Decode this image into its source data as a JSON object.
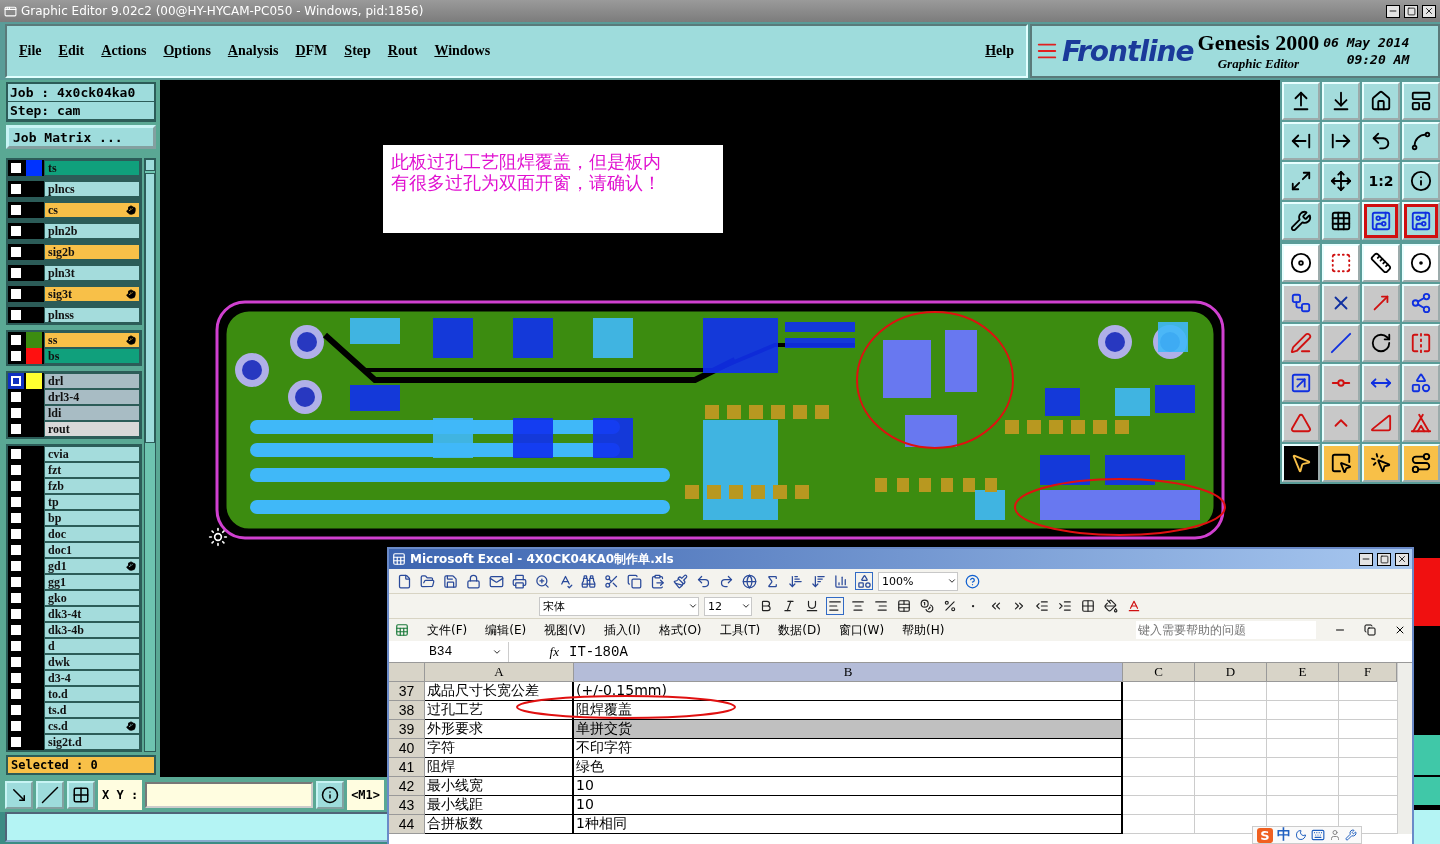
{
  "window": {
    "title": "Graphic Editor 9.02c2 (00@HY-HYCAM-PC050 - Windows, pid:1856)"
  },
  "menu": [
    "File",
    "Edit",
    "Actions",
    "Options",
    "Analysis",
    "DFM",
    "Step",
    "Rout",
    "Windows"
  ],
  "help_menu": "Help",
  "brand": {
    "logo": "Frontline",
    "product": "Genesis 2000",
    "subtitle": "Graphic Editor",
    "date": "06 May 2014",
    "time": "09:20 AM"
  },
  "job": {
    "job": "Job : 4x0ck04ka0",
    "step": "Step: cam",
    "matrix_button": "Job Matrix ..."
  },
  "layer_groups": [
    [
      {
        "name": "ts",
        "kind": "mask",
        "color": "#0033ff",
        "marked": false,
        "selected": false
      },
      {
        "name": "plncs",
        "kind": "plane",
        "marked": false,
        "selected": false
      },
      {
        "name": "cs",
        "kind": "signal",
        "marked": true,
        "selected": false
      },
      {
        "name": "pln2b",
        "kind": "plane",
        "marked": false,
        "selected": false
      },
      {
        "name": "sig2b",
        "kind": "signal",
        "marked": false,
        "selected": false
      },
      {
        "name": "pln3t",
        "kind": "plane",
        "marked": false,
        "selected": false
      },
      {
        "name": "sig3t",
        "kind": "signal",
        "marked": true,
        "selected": false
      },
      {
        "name": "plnss",
        "kind": "plane",
        "marked": false,
        "selected": false
      }
    ],
    [
      {
        "name": "ss",
        "kind": "signal",
        "color": "#3c8c10",
        "marked": true,
        "selected": false
      },
      {
        "name": "bs",
        "kind": "mask",
        "color": "#ff1010",
        "marked": false,
        "selected": false
      }
    ],
    [
      {
        "name": "drl",
        "kind": "drill",
        "color": "#ffff30",
        "marked": false,
        "selected": true
      },
      {
        "name": "drl3-4",
        "kind": "drill",
        "marked": false,
        "selected": false
      },
      {
        "name": "ldi",
        "kind": "drill",
        "marked": false,
        "selected": false
      },
      {
        "name": "rout",
        "kind": "rout",
        "marked": false,
        "selected": false
      }
    ],
    [
      {
        "name": "cvia",
        "kind": "document",
        "marked": false,
        "selected": false
      },
      {
        "name": "fzt",
        "kind": "document",
        "marked": false,
        "selected": false
      },
      {
        "name": "fzb",
        "kind": "document",
        "marked": false,
        "selected": false
      },
      {
        "name": "tp",
        "kind": "document",
        "marked": false,
        "selected": false
      },
      {
        "name": "bp",
        "kind": "document",
        "marked": false,
        "selected": false
      },
      {
        "name": "doc",
        "kind": "document",
        "marked": false,
        "selected": false
      },
      {
        "name": "doc1",
        "kind": "document",
        "marked": false,
        "selected": false
      },
      {
        "name": "gd1",
        "kind": "document",
        "marked": true,
        "selected": false
      },
      {
        "name": "gg1",
        "kind": "document",
        "marked": false,
        "selected": false
      },
      {
        "name": "gko",
        "kind": "document",
        "marked": false,
        "selected": false
      },
      {
        "name": "dk3-4t",
        "kind": "document",
        "marked": false,
        "selected": false
      },
      {
        "name": "dk3-4b",
        "kind": "document",
        "marked": false,
        "selected": false
      },
      {
        "name": "d",
        "kind": "document",
        "marked": false,
        "selected": false
      },
      {
        "name": "dwk",
        "kind": "document",
        "marked": false,
        "selected": false
      },
      {
        "name": "d3-4",
        "kind": "document",
        "marked": false,
        "selected": false
      },
      {
        "name": "to.d",
        "kind": "document",
        "marked": false,
        "selected": false
      },
      {
        "name": "ts.d",
        "kind": "document",
        "marked": false,
        "selected": false
      },
      {
        "name": "cs.d",
        "kind": "document",
        "marked": true,
        "selected": false
      },
      {
        "name": "sig2t.d",
        "kind": "document",
        "marked": false,
        "selected": false
      }
    ]
  ],
  "selected_count": "Selected : 0",
  "coord": {
    "label": "X Y :",
    "units": "<M1>"
  },
  "canvas_note": "此板过孔工艺阻焊覆盖，但是板内有很多过孔为双面开窗，请确认！",
  "view_tools": [
    {
      "highlighted": false
    },
    {
      "highlighted": false
    },
    {
      "highlighted": false
    },
    {
      "highlighted": false
    },
    {
      "highlighted": false
    },
    {
      "highlighted": false
    },
    {
      "highlighted": false
    },
    {
      "highlighted": false
    },
    {
      "highlighted": false
    },
    {
      "highlighted": false
    },
    {
      "highlighted": false,
      "label": "1:2"
    },
    {
      "highlighted": false
    },
    {
      "highlighted": false
    },
    {
      "highlighted": false
    },
    {
      "highlighted": true
    },
    {
      "highlighted": true
    }
  ],
  "pointer_tools": [
    {
      "selected": true
    },
    {
      "selected": false
    },
    {
      "selected": false
    },
    {
      "selected": false
    }
  ],
  "excel": {
    "title": "Microsoft Excel - 4X0CK04KA0制作单.xls",
    "zoom": "100%",
    "font": "宋体",
    "size": "12",
    "menu": [
      "文件(F)",
      "编辑(E)",
      "视图(V)",
      "插入(I)",
      "格式(O)",
      "工具(T)",
      "数据(D)",
      "窗口(W)",
      "帮助(H)"
    ],
    "help_placeholder": "键入需要帮助的问题",
    "cell_ref": "B34",
    "function_label": "fx",
    "formula": "IT-180A",
    "columns": [
      "A",
      "B",
      "C",
      "D",
      "E",
      "F"
    ],
    "rows": [
      {
        "number": "37",
        "a": "成品尺寸长宽公差",
        "b": "(+/-0.15mm)",
        "selected": false
      },
      {
        "number": "38",
        "a": "过孔工艺",
        "b": "阻焊覆盖",
        "selected": false
      },
      {
        "number": "39",
        "a": "外形要求",
        "b": "单拼交货",
        "selected": true
      },
      {
        "number": "40",
        "a": "字符",
        "b": "不印字符",
        "selected": false
      },
      {
        "number": "41",
        "a": "阻焊",
        "b": "绿色",
        "selected": false
      },
      {
        "number": "42",
        "a": "最小线宽",
        "b": "10",
        "selected": false
      },
      {
        "number": "43",
        "a": "最小线距",
        "b": "10",
        "selected": false
      },
      {
        "number": "44",
        "a": "合拼板数",
        "b": "1种相同",
        "selected": false
      }
    ]
  },
  "ime": {
    "logo": "S",
    "mode": "中"
  }
}
